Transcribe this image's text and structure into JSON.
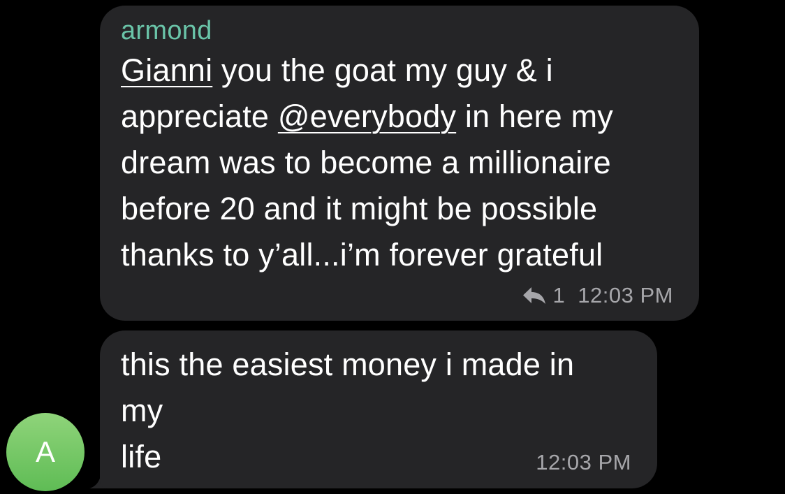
{
  "colors": {
    "background": "#000000",
    "bubble": "#252527",
    "sender_name": "#6ac4a8",
    "meta_text": "#a6a6aa",
    "avatar": "#6cc460"
  },
  "messages": [
    {
      "sender": "armond",
      "mention_gianni": "Gianni",
      "text_line1_rest": " you the goat my guy & i",
      "text_line2_start": "appreciate ",
      "mention_everybody": "@everybody",
      "text_line2_rest": " in here my",
      "text_line3": "dream was to become a millionaire",
      "text_line4": "before 20 and it might be possible",
      "text_line5": "thanks to y’all...i’m forever grateful",
      "reply_icon": "reply-arrow-icon",
      "reply_count": "1",
      "time": "12:03 PM"
    },
    {
      "text_line1": "this the easiest money i made in",
      "text_line2": "my",
      "text_line3": "life",
      "time": "12:03 PM"
    }
  ],
  "avatar": {
    "initial": "A"
  }
}
